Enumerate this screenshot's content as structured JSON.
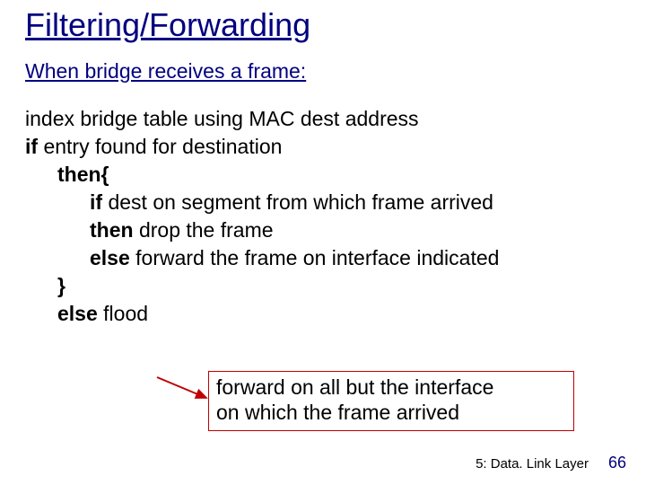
{
  "title": "Filtering/Forwarding",
  "subtitle": "When bridge receives a frame:",
  "code": {
    "l1": "index bridge table using MAC dest address",
    "l2_kw": "if",
    "l2_rest": " entry found for destination",
    "l3_kw": "then{",
    "l4_kw": "if",
    "l4_rest": " dest on segment from which frame arrived",
    "l5_kw": "then",
    "l5_rest": " drop the frame",
    "l6_kw": "else",
    "l6_rest": " forward the frame on interface indicated",
    "l7_kw": "}",
    "l8_kw": "else",
    "l8_rest": " flood"
  },
  "callout": {
    "line1": "forward on all but the interface",
    "line2": "on which the frame arrived"
  },
  "footer": {
    "chapter": "5: Data. Link Layer",
    "page": "66"
  },
  "colors": {
    "heading": "#000080",
    "box_border": "#C00000"
  }
}
